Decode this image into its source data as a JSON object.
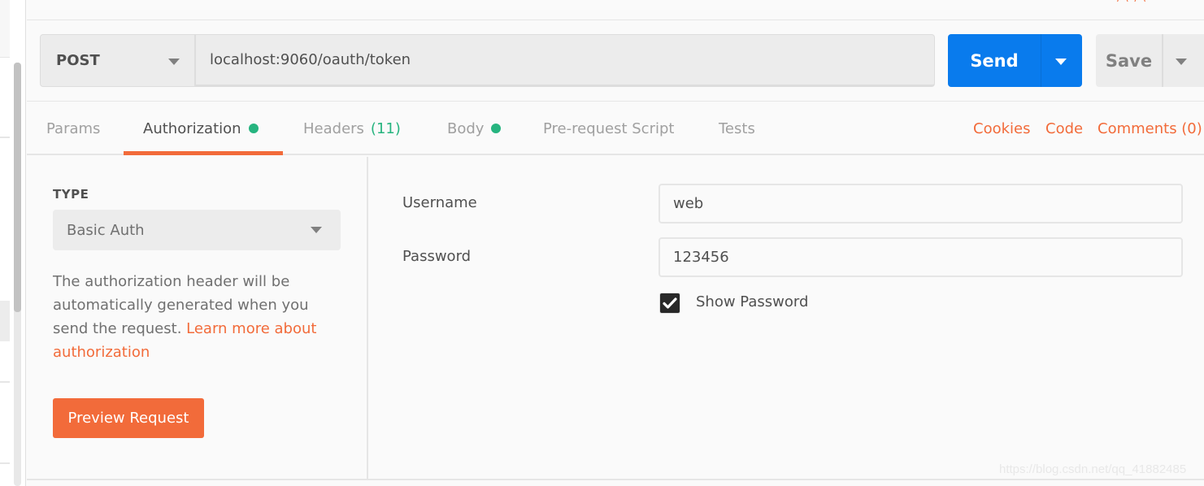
{
  "request": {
    "method": "POST",
    "url": "localhost:9060/oauth/token",
    "send_label": "Send",
    "save_label": "Save"
  },
  "tabs": [
    {
      "label": "Params"
    },
    {
      "label": "Authorization",
      "has_dot": true
    },
    {
      "label": "Headers",
      "count": "(11)"
    },
    {
      "label": "Body",
      "has_dot": true
    },
    {
      "label": "Pre-request Script"
    },
    {
      "label": "Tests"
    }
  ],
  "links": {
    "cookies": "Cookies",
    "code": "Code",
    "comments": "Comments (0)"
  },
  "auth": {
    "type_label": "TYPE",
    "type_value": "Basic Auth",
    "description": "The authorization header will be automatically generated when you send the request. ",
    "learn_more": "Learn more about authorization",
    "preview_label": "Preview Request",
    "username_label": "Username",
    "username_value": "web",
    "password_label": "Password",
    "password_value": "123456",
    "show_password_label": "Show Password",
    "show_password_checked": true
  },
  "watermark": "https://blog.csdn.net/qq_41882485",
  "colors": {
    "accent": "#f26b3a",
    "send": "#097bed",
    "dot": "#26b47f"
  }
}
